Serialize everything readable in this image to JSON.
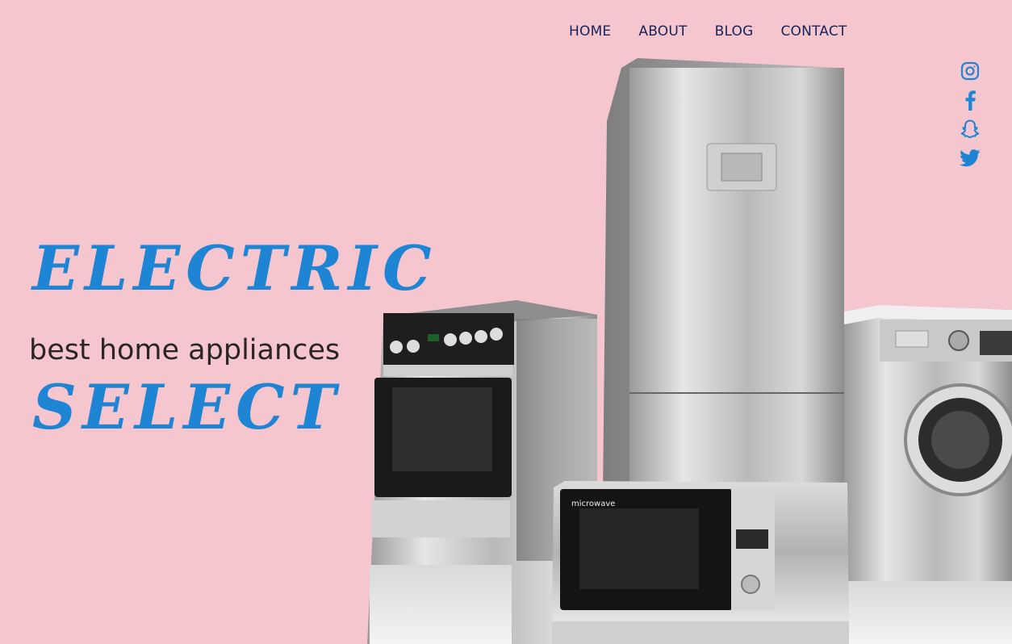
{
  "nav": {
    "items": [
      "HOME",
      "ABOUT",
      "BLOG",
      "CONTACT"
    ]
  },
  "social": {
    "color": "#1e84d4",
    "icons": [
      "instagram-icon",
      "facebook-icon",
      "snapchat-icon",
      "twitter-icon"
    ]
  },
  "hero": {
    "title_line1": "ELECTRIC",
    "title_line2": "SELECT",
    "tagline": "best home appliances",
    "title_color": "#1e84d4",
    "background": "#f6c6cf"
  },
  "microwave": {
    "label": "microwave"
  }
}
